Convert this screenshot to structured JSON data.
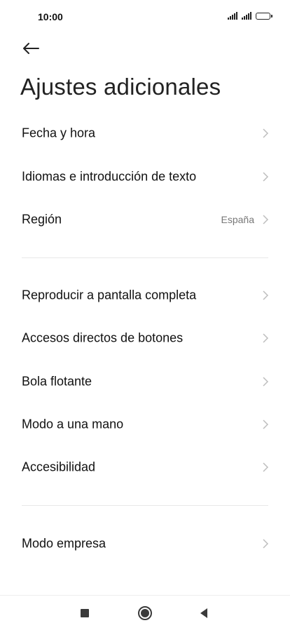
{
  "status_bar": {
    "time": "10:00"
  },
  "header": {
    "title": "Ajustes adicionales"
  },
  "sections": [
    {
      "items": [
        {
          "label": "Fecha y hora"
        },
        {
          "label": "Idiomas e introducción de texto"
        },
        {
          "label": "Región",
          "value": "España"
        }
      ]
    },
    {
      "items": [
        {
          "label": "Reproducir a pantalla completa"
        },
        {
          "label": "Accesos directos de botones"
        },
        {
          "label": "Bola flotante"
        },
        {
          "label": "Modo a una mano"
        },
        {
          "label": "Accesibilidad"
        }
      ]
    },
    {
      "items": [
        {
          "label": "Modo empresa"
        }
      ]
    }
  ],
  "icons": {
    "back": "arrow-left-icon",
    "chevron": "chevron-right-icon",
    "nav_recents": "square-icon",
    "nav_home": "circle-icon",
    "nav_back": "triangle-left-icon"
  },
  "colors": {
    "chevron": "#bdbdbd",
    "value_text": "#777777",
    "divider": "#e8e8e8"
  }
}
